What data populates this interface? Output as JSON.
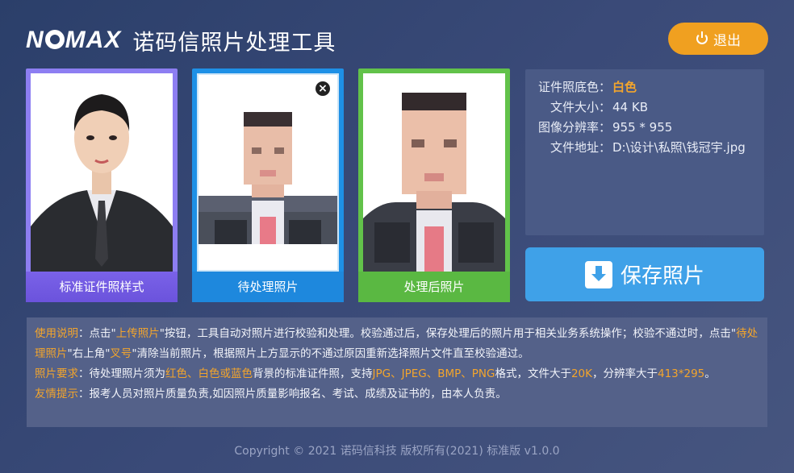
{
  "header": {
    "logo_text": "NOMAX",
    "app_title": "诺码信照片处理工具",
    "exit_label": "退出"
  },
  "cards": {
    "sample": {
      "label": "标准证件照样式"
    },
    "pending": {
      "label": "待处理照片"
    },
    "processed": {
      "label": "处理后照片"
    }
  },
  "info": {
    "bg_color_key": "证件照底色：",
    "bg_color_val": "白色",
    "file_size_key": "文件大小：",
    "file_size_val": "44 KB",
    "resolution_key": "图像分辨率：",
    "resolution_val": "955 * 955",
    "path_key": "文件地址：",
    "path_val": "D:\\设计\\私照\\钱冠宇.jpg"
  },
  "save_label": "保存照片",
  "notes": {
    "usage_title": "使用说明",
    "usage_1": "：点击\"",
    "usage_upload": "上传照片",
    "usage_2": "\"按钮，工具自动对照片进行校验和处理。校验通过后，保存处理后的照片用于相关业务系统操作；校验不通过时，点击\"",
    "usage_pending": "待处理照片",
    "usage_3": "\"右上角\"",
    "usage_x": "叉号",
    "usage_4": "\"清除当前照片，根据照片上方显示的不通过原因重新选择照片文件直至校验通过。",
    "req_title": "照片要求",
    "req_1": "：待处理照片须为",
    "req_colors": "红色、白色或蓝色",
    "req_2": "背景的标准证件照，支持",
    "req_formats": "JPG、JPEG、BMP、PNG",
    "req_3": "格式，文件大于",
    "req_size": "20K",
    "req_4": "，分辨率大于",
    "req_res": "413*295",
    "req_5": "。",
    "tip_title": "友情提示",
    "tip_text": "：报考人员对照片质量负责,如因照片质量影响报名、考试、成绩及证书的，由本人负责。"
  },
  "footer": "Copyright © 2021 诺码信科技 版权所有(2021) 标准版 v1.0.0"
}
